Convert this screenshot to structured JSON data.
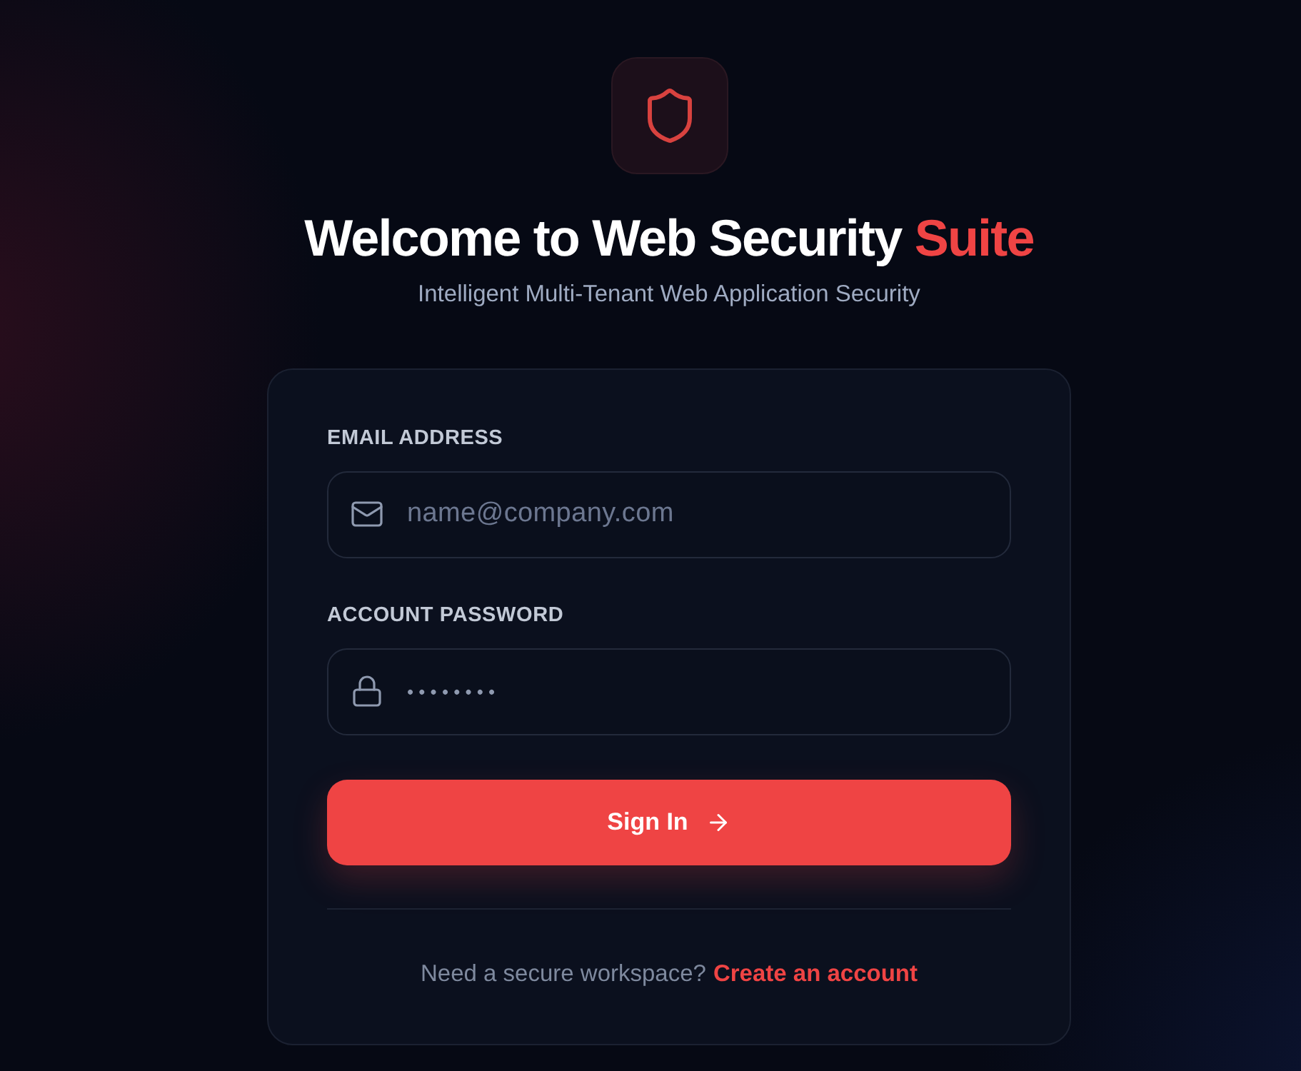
{
  "header": {
    "title": "Welcome to Web Security",
    "title_highlight": "Suite",
    "subtitle": "Intelligent Multi-Tenant Web Application Security"
  },
  "form": {
    "fields": [
      {
        "kind": "email",
        "label": "EMAIL ADDRESS",
        "placeholder": "name@company.com"
      },
      {
        "kind": "password",
        "label": "ACCOUNT PASSWORD",
        "value": "••••••••"
      }
    ],
    "submit": {
      "label": "Sign In"
    },
    "footer": {
      "prompt": "Need a secure workspace?",
      "link": "Create an account"
    }
  }
}
